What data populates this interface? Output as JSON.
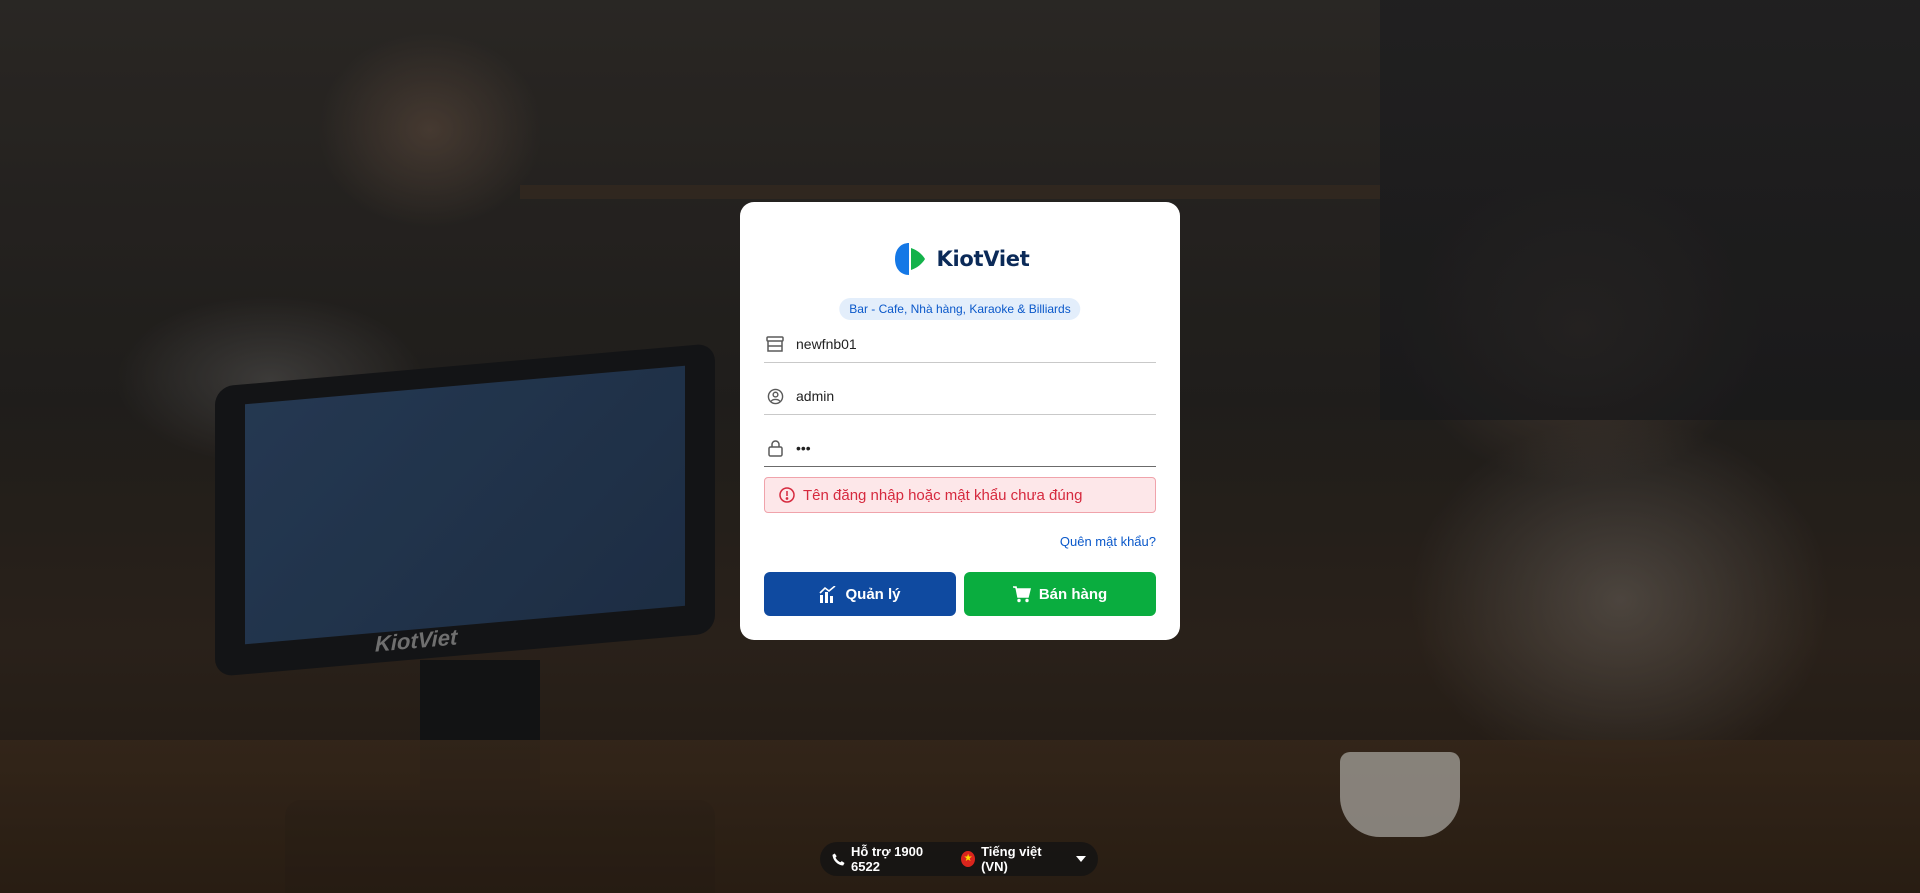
{
  "brand": {
    "name": "KiotViet",
    "tagline": "Bar - Cafe, Nhà hàng, Karaoke & Billiards"
  },
  "background": {
    "terminal_brand": "KiotViet"
  },
  "login": {
    "store_value": "newfnb01",
    "username_value": "admin",
    "password_value": "123",
    "error_message": "Tên đăng nhập hoặc mật khẩu chưa đúng",
    "forgot_password": "Quên mật khẩu?",
    "manage_button": "Quản lý",
    "sell_button": "Bán hàng"
  },
  "footer": {
    "support": "Hỗ trợ 1900 6522",
    "language": "Tiếng việt (VN)"
  },
  "colors": {
    "brand_navy": "#0f4aa0",
    "brand_green": "#0aad3f",
    "error_red": "#d6293e",
    "link_blue": "#0a58ca"
  },
  "icons": {
    "store": "store-icon",
    "user": "user-circle-icon",
    "lock": "lock-icon",
    "error": "alert-circle-icon",
    "manage": "chart-icon",
    "sell": "cart-icon",
    "phone": "phone-icon",
    "flag": "vietnam-flag-icon",
    "dropdown": "caret-down-icon"
  }
}
